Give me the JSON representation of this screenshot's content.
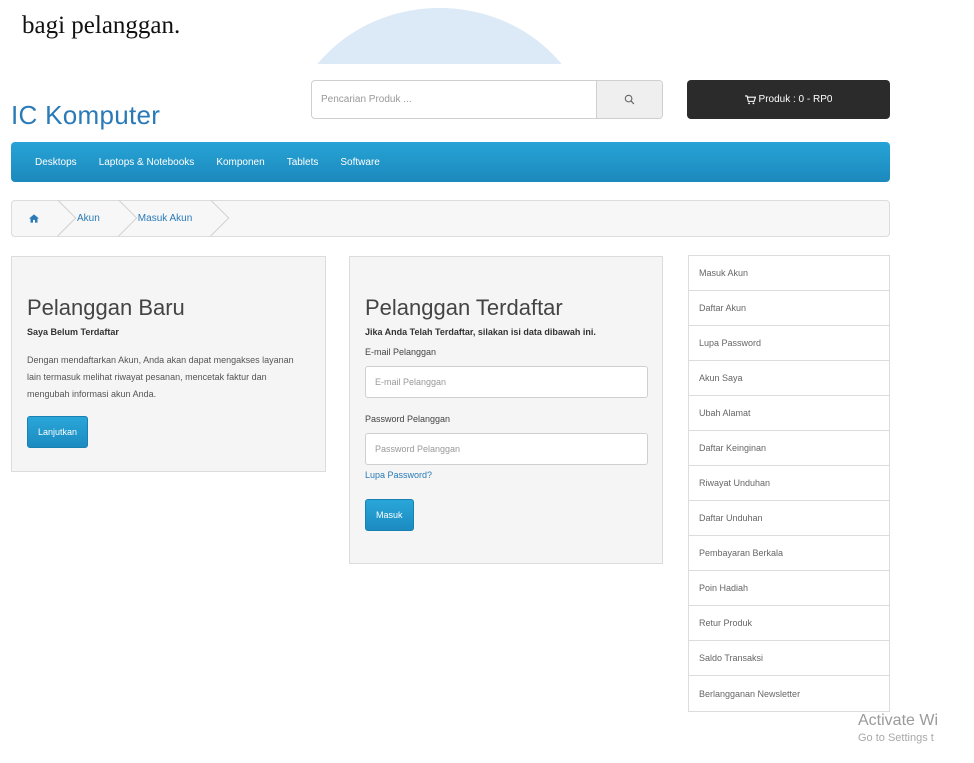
{
  "document": {
    "caption": "bagi pelanggan."
  },
  "header": {
    "logo": "IC Komputer",
    "search_placeholder": "Pencarian Produk ...",
    "cart_label": "Produk : 0 - RP0"
  },
  "nav": {
    "items": [
      {
        "label": "Desktops"
      },
      {
        "label": "Laptops & Notebooks"
      },
      {
        "label": "Komponen"
      },
      {
        "label": "Tablets"
      },
      {
        "label": "Software"
      }
    ]
  },
  "breadcrumb": {
    "items": [
      {
        "label": "Akun"
      },
      {
        "label": "Masuk Akun"
      }
    ]
  },
  "new_customer": {
    "title": "Pelanggan Baru",
    "subtitle": "Saya Belum Terdaftar",
    "description": "Dengan mendaftarkan Akun, Anda akan dapat mengakses layanan lain termasuk melihat riwayat pesanan, mencetak faktur dan mengubah informasi akun Anda.",
    "button": "Lanjutkan"
  },
  "registered": {
    "title": "Pelanggan Terdaftar",
    "subtitle": "Jika Anda Telah Terdaftar, silakan isi data dibawah ini.",
    "email_label": "E-mail Pelanggan",
    "email_placeholder": "E-mail Pelanggan",
    "password_label": "Password Pelanggan",
    "password_placeholder": "Password Pelanggan",
    "forgot_link": "Lupa Password?",
    "button": "Masuk"
  },
  "sidebar": {
    "items": [
      {
        "label": "Masuk Akun"
      },
      {
        "label": "Daftar Akun"
      },
      {
        "label": "Lupa Password"
      },
      {
        "label": "Akun Saya"
      },
      {
        "label": "Ubah Alamat"
      },
      {
        "label": "Daftar Keinginan"
      },
      {
        "label": "Riwayat Unduhan"
      },
      {
        "label": "Daftar Unduhan"
      },
      {
        "label": "Pembayaran Berkala"
      },
      {
        "label": "Poin Hadiah"
      },
      {
        "label": "Retur Produk"
      },
      {
        "label": "Saldo Transaksi"
      },
      {
        "label": "Berlangganan Newsletter"
      }
    ]
  },
  "watermark": {
    "title": "Activate Wi",
    "subtitle": "Go to Settings t"
  },
  "colors": {
    "brand_blue": "#2a7ab8",
    "nav_blue": "#1f95c9",
    "cart_dark": "#2b2b2b"
  },
  "icons": [
    "search-icon",
    "cart-icon",
    "home-icon"
  ]
}
